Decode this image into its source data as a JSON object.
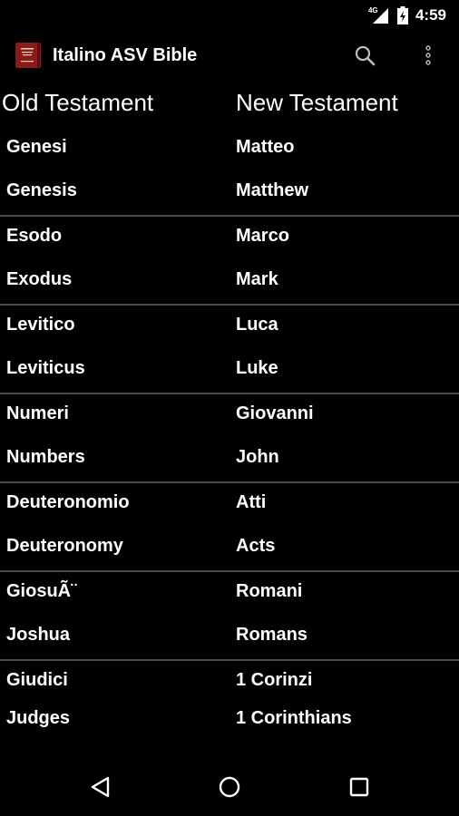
{
  "status": {
    "network": "4G",
    "time": "4:59"
  },
  "appbar": {
    "title": "Italino ASV Bible",
    "icon": "bible-icon"
  },
  "headers": {
    "old": "Old Testament",
    "new": "New Testament"
  },
  "books": [
    {
      "old_it": "Genesi",
      "old_en": "Genesis",
      "new_it": "Matteo",
      "new_en": "Matthew"
    },
    {
      "old_it": "Esodo",
      "old_en": "Exodus",
      "new_it": "Marco",
      "new_en": "Mark"
    },
    {
      "old_it": "Levitico",
      "old_en": "Leviticus",
      "new_it": "Luca",
      "new_en": "Luke"
    },
    {
      "old_it": "Numeri",
      "old_en": "Numbers",
      "new_it": "Giovanni",
      "new_en": "John"
    },
    {
      "old_it": "Deuteronomio",
      "old_en": "Deuteronomy",
      "new_it": "Atti",
      "new_en": "Acts"
    },
    {
      "old_it": "GiosuÃ¨",
      "old_en": "Joshua",
      "new_it": "Romani",
      "new_en": "Romans"
    },
    {
      "old_it": "Giudici",
      "old_en": "Judges",
      "new_it": "1 Corinzi",
      "new_en": "1 Corinthians"
    }
  ],
  "icons": {
    "search": "search-icon",
    "overflow": "more-vert-icon",
    "back": "back-triangle-icon",
    "home": "home-circle-icon",
    "recents": "recents-square-icon"
  },
  "colors": {
    "background": "#000000",
    "text": "#ffffff",
    "divider": "#4a4a4a",
    "bible_cover": "#8b1a1a"
  }
}
